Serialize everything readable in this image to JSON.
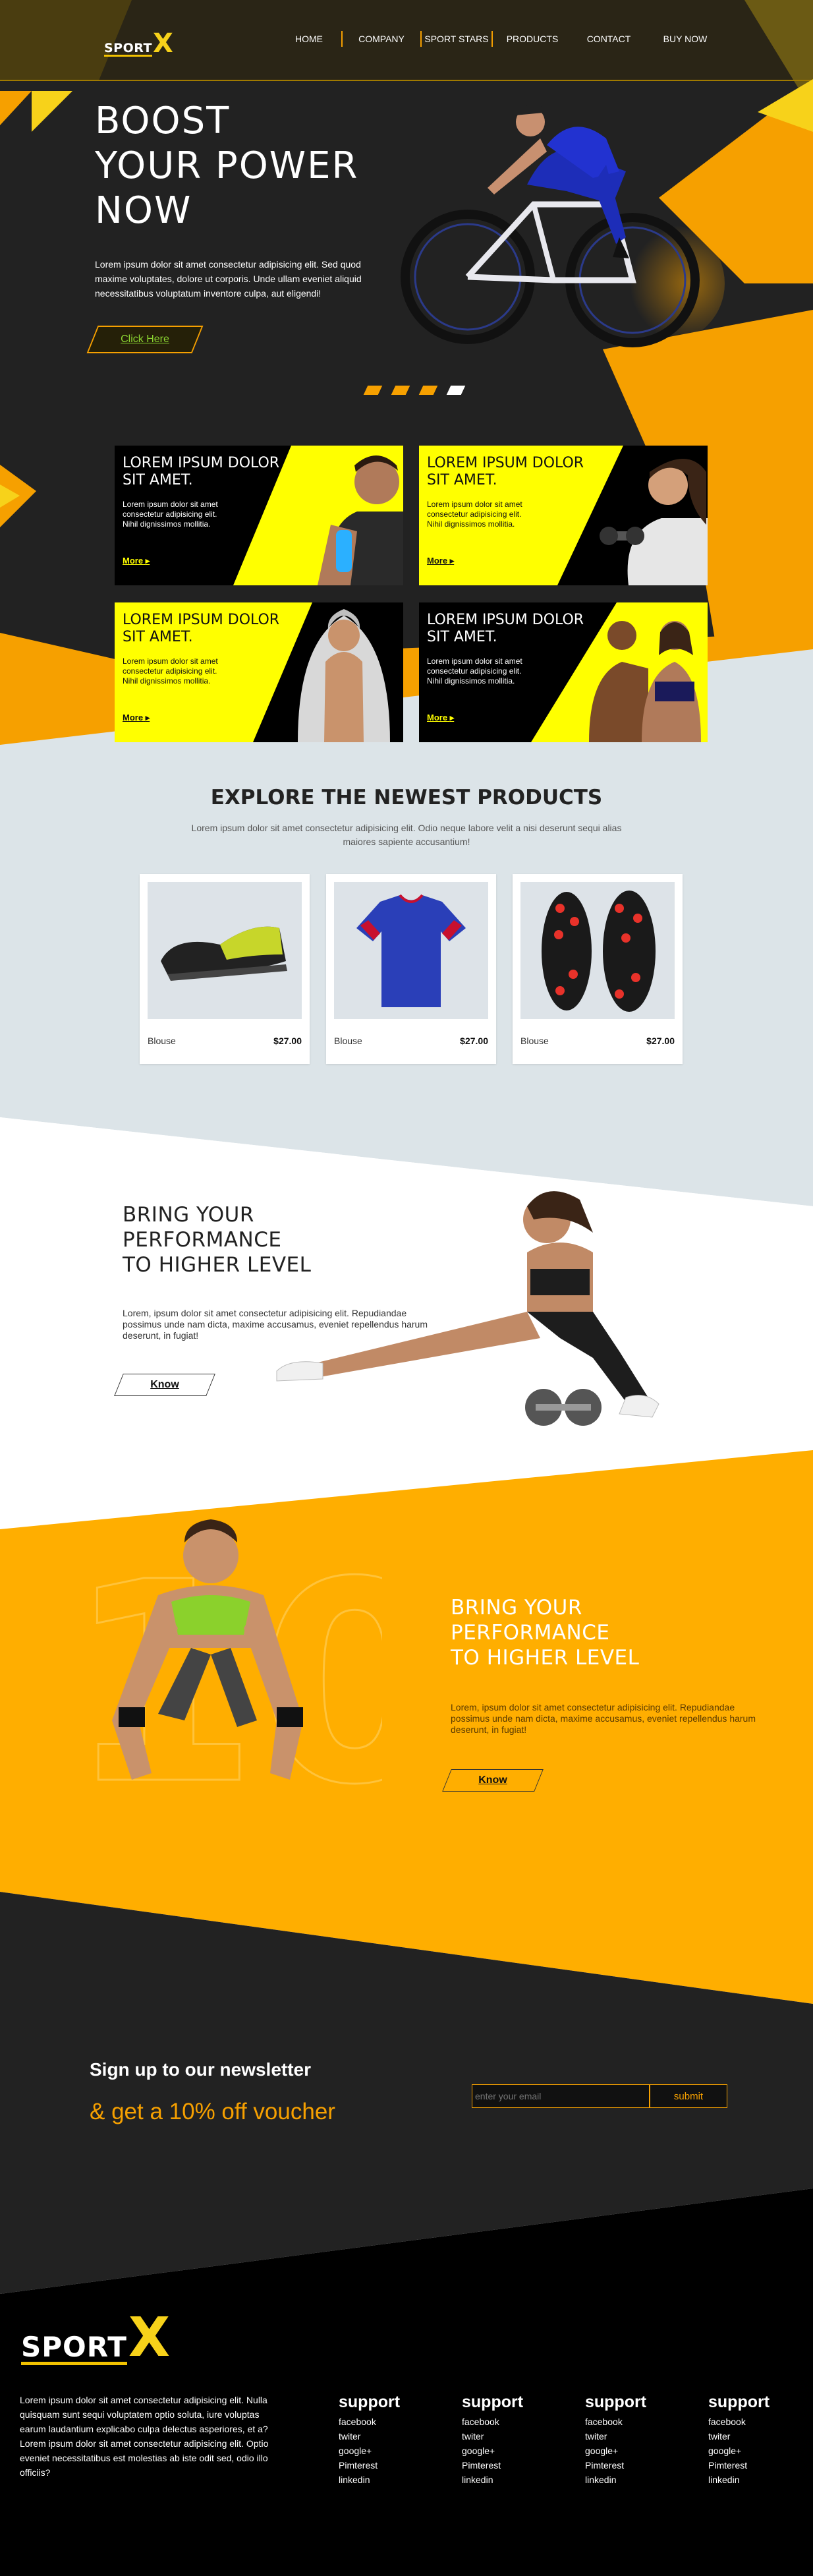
{
  "brand": {
    "logo_word": "SPORT",
    "logo_mark": "X",
    "accent": "#f6a000",
    "yellow": "#ffff00",
    "dark": "#222222"
  },
  "nav": {
    "items": [
      {
        "label": "HOME"
      },
      {
        "label": "COMPANY"
      },
      {
        "label": "SPORT STARS"
      },
      {
        "label": "PRODUCTS"
      },
      {
        "label": "CONTACT"
      },
      {
        "label": "BUY NOW"
      }
    ]
  },
  "hero": {
    "title_line1": "BOOST",
    "title_line2": "YOUR POWER",
    "title_line3": "NOW",
    "text": "Lorem ipsum dolor sit amet consectetur adipisicing elit. Sed quod maxime voluptates, dolore ut corporis. Unde ullam eveniet aliquid necessitatibus voluptatum inventore culpa, aut eligendi!",
    "button": "Click Here",
    "slides": 4,
    "active_slide": 4
  },
  "features": [
    {
      "title": "LOREM IPSUM DOLOR SIT AMET.",
      "text": "Lorem ipsum dolor sit amet consectetur adipisicing elit. Nihil dignissimos mollitia.",
      "more": "More"
    },
    {
      "title": "LOREM IPSUM DOLOR SIT AMET.",
      "text": "Lorem ipsum dolor sit amet consectetur adipisicing elit. Nihil dignissimos mollitia.",
      "more": "More"
    },
    {
      "title": "LOREM IPSUM DOLOR SIT AMET.",
      "text": "Lorem ipsum dolor sit amet consectetur adipisicing elit. Nihil dignissimos mollitia.",
      "more": "More"
    },
    {
      "title": "LOREM IPSUM DOLOR SIT AMET.",
      "text": "Lorem ipsum dolor sit amet consectetur adipisicing elit. Nihil dignissimos mollitia.",
      "more": "More"
    }
  ],
  "products": {
    "title": "EXPLORE THE NEWEST PRODUCTS",
    "subtitle": "Lorem ipsum dolor sit amet consectetur adipisicing elit. Odio neque labore velit a nisi deserunt sequi alias maiores sapiente accusantium!",
    "items": [
      {
        "name": "Blouse",
        "price": "$27.00",
        "icon": "football-boot-icon"
      },
      {
        "name": "Blouse",
        "price": "$27.00",
        "icon": "jersey-icon"
      },
      {
        "name": "Blouse",
        "price": "$27.00",
        "icon": "cleats-icon"
      }
    ]
  },
  "perf1": {
    "line1": "BRING YOUR",
    "line2": "PERFORMANCE",
    "line3": "TO HIGHER LEVEL",
    "text": "Lorem, ipsum dolor sit amet consectetur adipisicing elit. Repudiandae possimus unde nam dicta, maxime accusamus, eveniet repellendus harum deserunt, in fugiat!",
    "button": "Know"
  },
  "perf2": {
    "line1": "BRING YOUR",
    "line2": "PERFORMANCE",
    "line3": "TO HIGHER LEVEL",
    "text": "Lorem, ipsum dolor sit amet consectetur adipisicing elit. Repudiandae possimus unde nam dicta, maxime accusamus, eveniet repellendus harum deserunt, in fugiat!",
    "button": "Know",
    "bg_numeral": "10"
  },
  "newsletter": {
    "title": "Sign up to our newsletter",
    "subtitle": "& get a 10% off voucher",
    "placeholder": "enter your email",
    "button": "submit"
  },
  "footer": {
    "about": "Lorem ipsum dolor sit amet consectetur adipisicing elit. Nulla quisquam sunt sequi voluptatem optio soluta, iure voluptas earum laudantium explicabo culpa delectus asperiores, et a?Lorem ipsum dolor sit amet consectetur adipisicing elit. Optio eveniet necessitatibus est molestias ab iste odit sed, odio illo officiis?",
    "columns": [
      {
        "title": "support",
        "links": [
          "facebook",
          "twiter",
          "google+",
          "Pimterest",
          "linkedin"
        ]
      },
      {
        "title": "support",
        "links": [
          "facebook",
          "twiter",
          "google+",
          "Pimterest",
          "linkedin"
        ]
      },
      {
        "title": "support",
        "links": [
          "facebook",
          "twiter",
          "google+",
          "Pimterest",
          "linkedin"
        ]
      },
      {
        "title": "support",
        "links": [
          "facebook",
          "twiter",
          "google+",
          "Pimterest",
          "linkedin"
        ]
      }
    ]
  }
}
